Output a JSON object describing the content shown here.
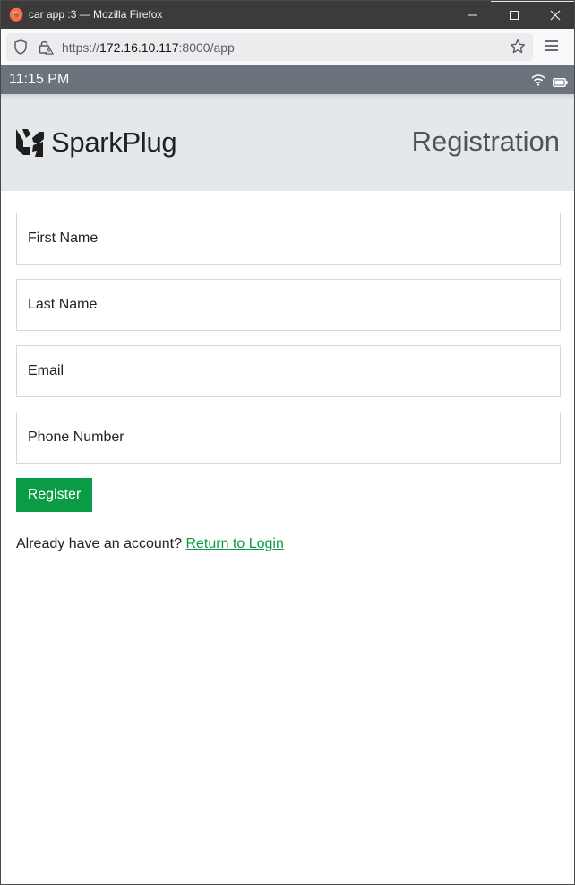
{
  "window": {
    "title": "car app :3 — Mozilla Firefox"
  },
  "browser": {
    "url_prefix": "https://",
    "url_host": "172.16.10.117",
    "url_suffix": ":8000/app"
  },
  "status_bar": {
    "time": "11:15 PM",
    "icons": [
      "wifi-icon",
      "battery-icon"
    ]
  },
  "header": {
    "brand": "SparkPlug",
    "page_title": "Registration"
  },
  "form": {
    "first_name_placeholder": "First Name",
    "last_name_placeholder": "Last Name",
    "email_placeholder": "Email",
    "phone_placeholder": "Phone Number",
    "register_label": "Register"
  },
  "footer": {
    "prompt": "Already have an account?",
    "link_label": "Return to Login"
  },
  "colors": {
    "accent": "#0a9b45",
    "status_bar": "#6b737c",
    "header_bg": "#e5e8ea",
    "titlebar": "#3c3b39"
  }
}
